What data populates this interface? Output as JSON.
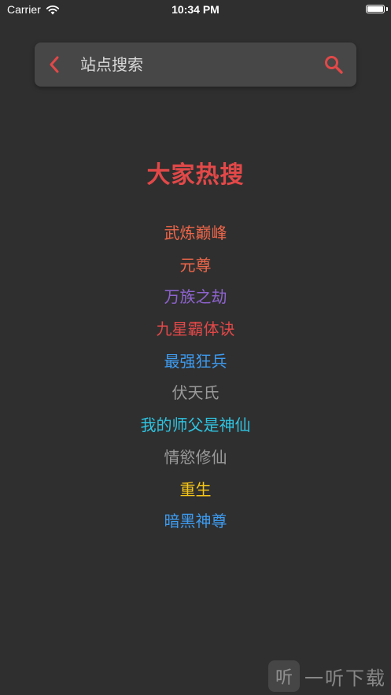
{
  "status_bar": {
    "carrier": "Carrier",
    "time": "10:34 PM"
  },
  "search": {
    "title": "站点搜索",
    "back_icon": "chevron-left-icon",
    "search_icon": "search-icon"
  },
  "hot": {
    "title": "大家热搜",
    "title_color": "#e24848",
    "items": [
      {
        "label": "武炼巅峰",
        "color": "#f0674a"
      },
      {
        "label": "元尊",
        "color": "#f0674a"
      },
      {
        "label": "万族之劫",
        "color": "#8e63cf"
      },
      {
        "label": "九星霸体诀",
        "color": "#e24848"
      },
      {
        "label": "最强狂兵",
        "color": "#3d9bf0"
      },
      {
        "label": "伏天氏",
        "color": "#9a9a9a"
      },
      {
        "label": "我的师父是神仙",
        "color": "#2fc3e0"
      },
      {
        "label": "情慾修仙",
        "color": "#9a9a9a"
      },
      {
        "label": "重生",
        "color": "#f5c518"
      },
      {
        "label": "暗黑神尊",
        "color": "#3d9bf0"
      }
    ]
  },
  "watermark": {
    "logo": "听",
    "text": "一听下载"
  },
  "colors": {
    "background": "#2f2f2f",
    "search_bar": "#474747",
    "accent": "#e24848"
  }
}
